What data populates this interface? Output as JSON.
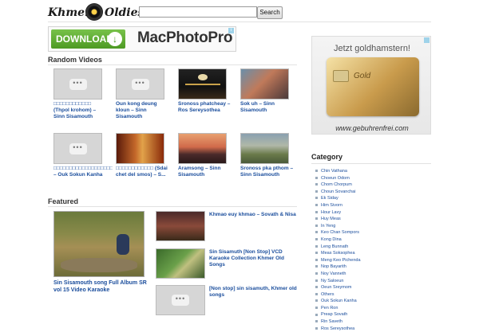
{
  "header": {
    "logo_left": "Khmer",
    "logo_right": "Oldies",
    "search_button": "Search",
    "search_value": ""
  },
  "banner": {
    "download_label": "DOWNLOAD",
    "arrow_glyph": "↓",
    "product": "MacPhotoPro"
  },
  "random_videos": {
    "title": "Random Videos",
    "row1": [
      {
        "caption": "□□□□□□□□□□□□ (Thpol krohom) – Sinn Sisamouth",
        "placeholder": true
      },
      {
        "caption": "Oun kong deung kloun – Sinn Sisamouth",
        "placeholder": true
      },
      {
        "caption": "Sronoss phatcheay – Ros Sereysothea",
        "placeholder": false
      },
      {
        "caption": "Sok uh – Sinn Sisamouth",
        "placeholder": false
      }
    ],
    "row2": [
      {
        "caption": "□□□□□□□□□□□□□□□□□□□□□ – Ouk Sokun Kanha",
        "placeholder": true
      },
      {
        "caption": "□□□□□□□□□□□□ (Sdai chet del smos) – S...",
        "placeholder": false
      },
      {
        "caption": "Aramsong – Sinn Sisamouth",
        "placeholder": false
      },
      {
        "caption": "Sronoss pka pthom – Sinn Sisamouth",
        "placeholder": false
      }
    ]
  },
  "featured": {
    "title": "Featured",
    "main_caption": "Sin Sisamouth song Full Album SR vol 15 Video Karaoke",
    "items": [
      "Khmao euy khmao – Sovath & Nisa",
      "Sin Sisamuth [Non Stop] VCD Karaoke Collection Khmer Old Songs",
      "[Non stop] sin sisamuth, Khmer old songs"
    ]
  },
  "side_ad": {
    "headline": "Jetzt goldhamstern!",
    "card_text": "Gold",
    "url": "www.gebuhrenfrei.com"
  },
  "category": {
    "title": "Category",
    "items": [
      "Chin Vathana",
      "Choeun Odom",
      "Chom Chorpum",
      "Choun Sovanchai",
      "Ek Siday",
      "Him Sivorn",
      "Hour Lavy",
      "Huy Meas",
      "In Yeng",
      "Keo Chan Sompors",
      "Kong Dina",
      "Leng Bunnath",
      "Meas Soksophea",
      "Meng Keo Pichenda",
      "Nop Bayarith",
      "Noy Vanneth",
      "Ny Saloeun",
      "Oeun Sreymom",
      "Others",
      "Ouk Sokun Kanha",
      "Pen Ron",
      "Preap Sovath",
      "Rin Saveth",
      "Ros Sereysothea"
    ]
  },
  "colors": {
    "link": "#1a4d9c",
    "download_green": "#5aa52d",
    "placeholder": "#d6d6d6"
  }
}
